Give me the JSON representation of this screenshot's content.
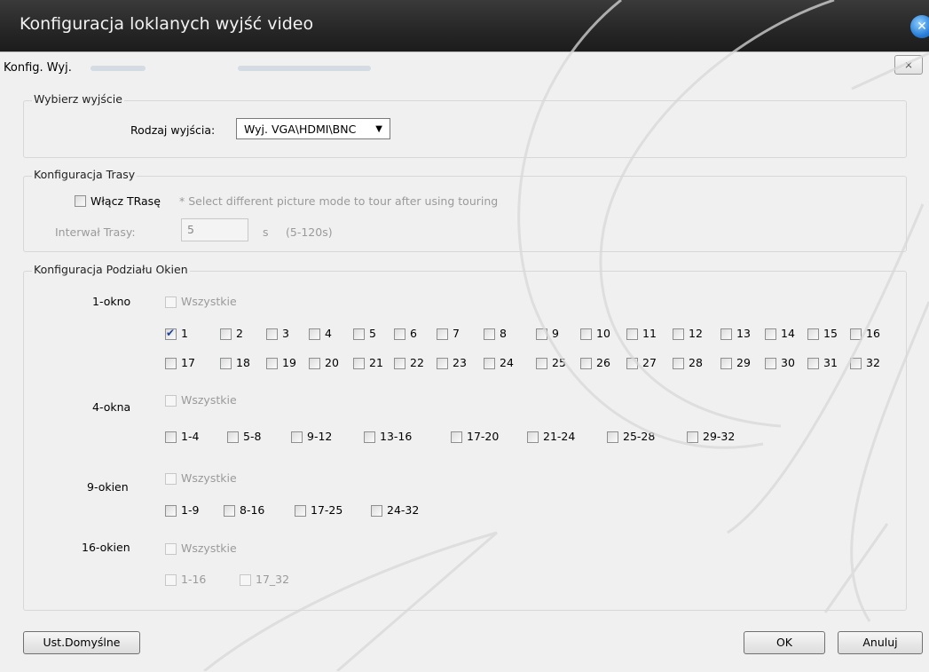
{
  "window": {
    "title": "Konfiguracja loklanych wyjść video"
  },
  "dialog": {
    "title": "Konfig. Wyj.",
    "close_glyph": "⨯"
  },
  "output_group": {
    "legend": "Wybierz wyjście",
    "type_label": "Rodzaj wyjścia:",
    "type_value": "Wyj. VGA\\HDMI\\BNC"
  },
  "tour_group": {
    "legend": "Konfiguracja Trasy",
    "enable_label": "Włącz TRasę",
    "hint": "* Select different picture mode to tour after using touring",
    "interval_label": "Interwał Trasy:",
    "interval_value": "5",
    "unit": "s",
    "range": "(5-120s)"
  },
  "split_group": {
    "legend": "Konfiguracja Podziału Okien",
    "all_label": "Wszystkie",
    "rows": [
      {
        "label": "1-okno"
      },
      {
        "label": "4-okna"
      },
      {
        "label": "9-okien"
      },
      {
        "label": "16-okien"
      }
    ],
    "one_window": [
      "1",
      "2",
      "3",
      "4",
      "5",
      "6",
      "7",
      "8",
      "9",
      "10",
      "11",
      "12",
      "13",
      "14",
      "15",
      "16",
      "17",
      "18",
      "19",
      "20",
      "21",
      "22",
      "23",
      "24",
      "25",
      "26",
      "27",
      "28",
      "29",
      "30",
      "31",
      "32"
    ],
    "four_windows": [
      "1-4",
      "5-8",
      "9-12",
      "13-16",
      "17-20",
      "21-24",
      "25-28",
      "29-32"
    ],
    "nine_windows": [
      "1-9",
      "8-16",
      "17-25",
      "24-32"
    ],
    "sixteen_windows": [
      "1-16",
      "17_32"
    ]
  },
  "footer": {
    "default_button": "Ust.Domyślne",
    "ok_button": "OK",
    "cancel_button": "Anuluj"
  },
  "colors": {
    "titlebar": "#262626",
    "dialog_bg": "#f0f0f0",
    "check": "#1f3f9a",
    "close_orb": "#2a7fd8"
  }
}
